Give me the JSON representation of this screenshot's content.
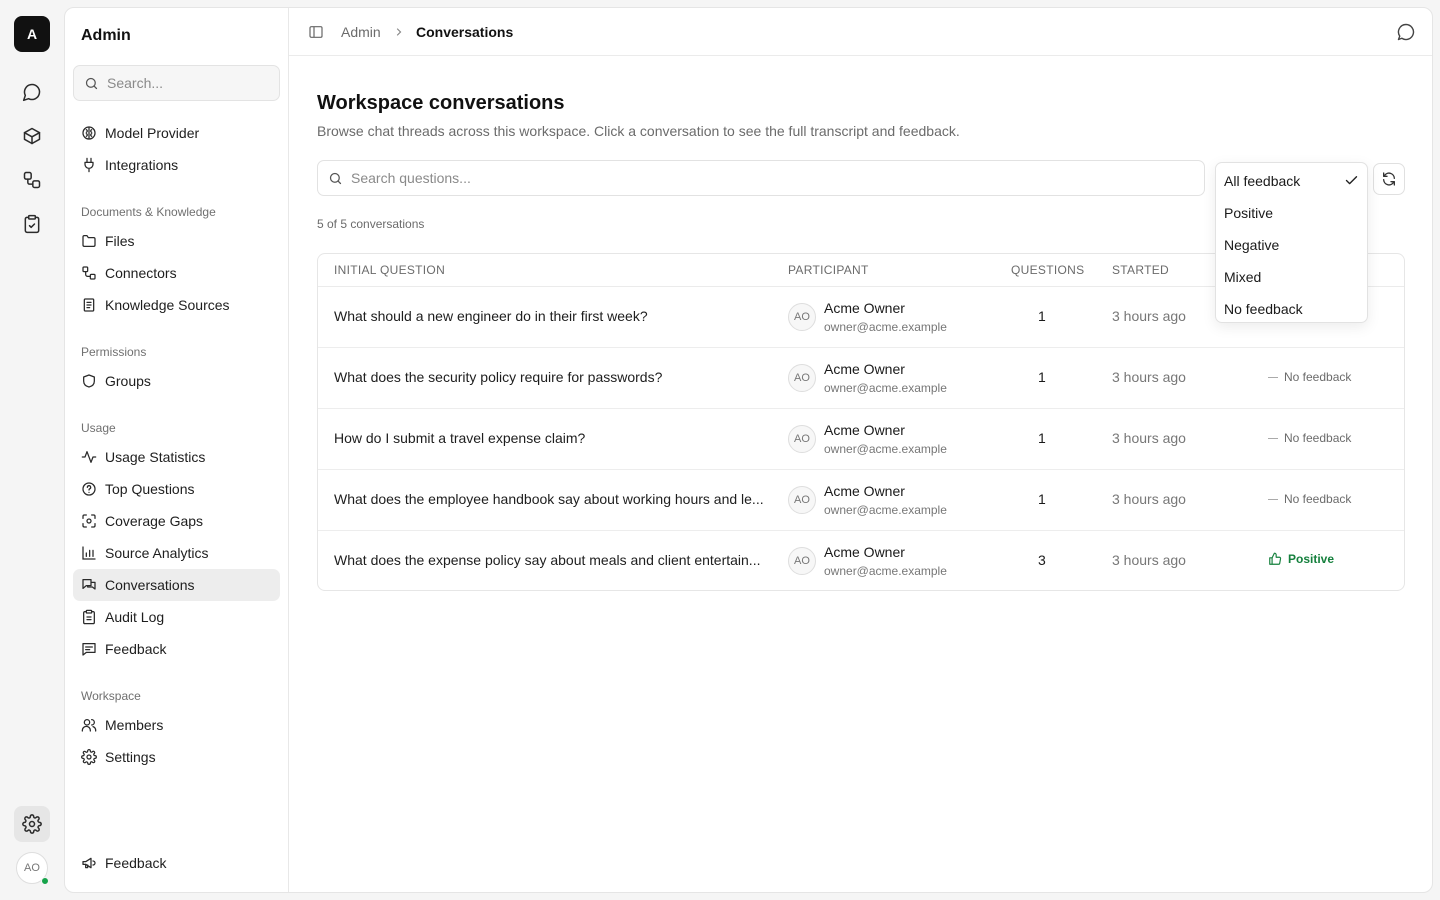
{
  "rail": {
    "logo_letter": "A",
    "avatar_initials": "AO"
  },
  "sidebar": {
    "title": "Admin",
    "search_placeholder": "Search...",
    "top_items": [
      {
        "label": "Model Provider",
        "icon": "brain-icon"
      },
      {
        "label": "Integrations",
        "icon": "plug-icon"
      }
    ],
    "sections": [
      {
        "title": "Documents & Knowledge",
        "items": [
          {
            "label": "Files",
            "icon": "folder-icon"
          },
          {
            "label": "Connectors",
            "icon": "connectors-icon"
          },
          {
            "label": "Knowledge Sources",
            "icon": "book-icon"
          }
        ]
      },
      {
        "title": "Permissions",
        "items": [
          {
            "label": "Groups",
            "icon": "shield-icon"
          }
        ]
      },
      {
        "title": "Usage",
        "items": [
          {
            "label": "Usage Statistics",
            "icon": "activity-icon"
          },
          {
            "label": "Top Questions",
            "icon": "help-circle-icon"
          },
          {
            "label": "Coverage Gaps",
            "icon": "scan-icon"
          },
          {
            "label": "Source Analytics",
            "icon": "bar-chart-icon"
          },
          {
            "label": "Conversations",
            "icon": "messages-icon",
            "active": true
          },
          {
            "label": "Audit Log",
            "icon": "clipboard-icon"
          },
          {
            "label": "Feedback",
            "icon": "message-square-icon"
          }
        ]
      },
      {
        "title": "Workspace",
        "items": [
          {
            "label": "Members",
            "icon": "users-icon"
          },
          {
            "label": "Settings",
            "icon": "gear-icon"
          }
        ]
      }
    ],
    "bottom_item": {
      "label": "Feedback",
      "icon": "megaphone-icon"
    }
  },
  "breadcrumb": {
    "parent": "Admin",
    "current": "Conversations"
  },
  "page": {
    "title": "Workspace conversations",
    "description": "Browse chat threads across this workspace. Click a conversation to see the full transcript and feedback.",
    "search_placeholder": "Search questions...",
    "count_text": "5 of 5 conversations"
  },
  "filter": {
    "options": [
      "All feedback",
      "Positive",
      "Negative",
      "Mixed",
      "No feedback"
    ],
    "selected": "All feedback"
  },
  "table": {
    "columns": {
      "question": "INITIAL QUESTION",
      "participant": "PARTICIPANT",
      "questions": "QUESTIONS",
      "started": "STARTED"
    },
    "rows": [
      {
        "question": "What should a new engineer do in their first week?",
        "initials": "AO",
        "name": "Acme Owner",
        "email": "owner@acme.example",
        "count": "1",
        "started": "3 hours ago",
        "feedback": ""
      },
      {
        "question": "What does the security policy require for passwords?",
        "initials": "AO",
        "name": "Acme Owner",
        "email": "owner@acme.example",
        "count": "1",
        "started": "3 hours ago",
        "feedback": "No feedback"
      },
      {
        "question": "How do I submit a travel expense claim?",
        "initials": "AO",
        "name": "Acme Owner",
        "email": "owner@acme.example",
        "count": "1",
        "started": "3 hours ago",
        "feedback": "No feedback"
      },
      {
        "question": "What does the employee handbook say about working hours and le...",
        "initials": "AO",
        "name": "Acme Owner",
        "email": "owner@acme.example",
        "count": "1",
        "started": "3 hours ago",
        "feedback": "No feedback"
      },
      {
        "question": "What does the expense policy say about meals and client entertain...",
        "initials": "AO",
        "name": "Acme Owner",
        "email": "owner@acme.example",
        "count": "3",
        "started": "3 hours ago",
        "feedback": "Positive"
      }
    ]
  },
  "colors": {
    "positive": "#15803d",
    "status_online": "#16a34a",
    "active_bg": "#ededed"
  }
}
